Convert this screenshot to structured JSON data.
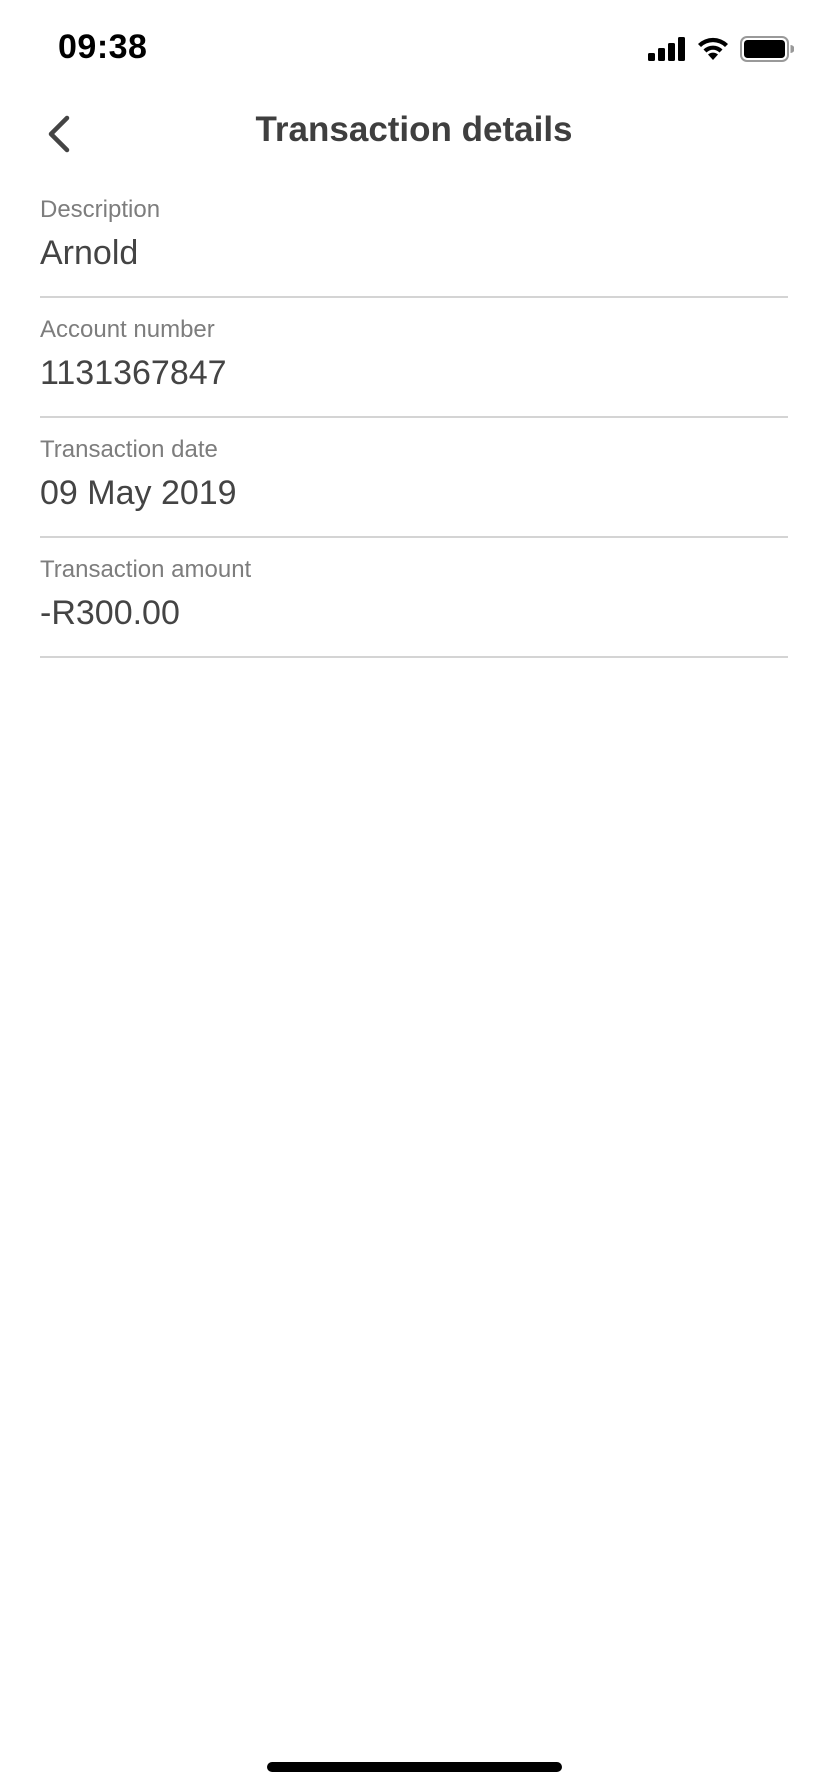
{
  "status_bar": {
    "time": "09:38",
    "icons": [
      "signal-icon",
      "wifi-icon",
      "battery-icon"
    ]
  },
  "header": {
    "back_icon": "chevron-left-icon",
    "title": "Transaction details"
  },
  "details": [
    {
      "label": "Description",
      "value": "Arnold"
    },
    {
      "label": "Account number",
      "value": "1131367847"
    },
    {
      "label": "Transaction date",
      "value": "09 May 2019"
    },
    {
      "label": "Transaction amount",
      "value": "-R300.00"
    }
  ],
  "colors": {
    "title": "#3f3f3f",
    "label": "#7d7d7d",
    "value": "#444444",
    "divider": "#d4d4d4"
  }
}
